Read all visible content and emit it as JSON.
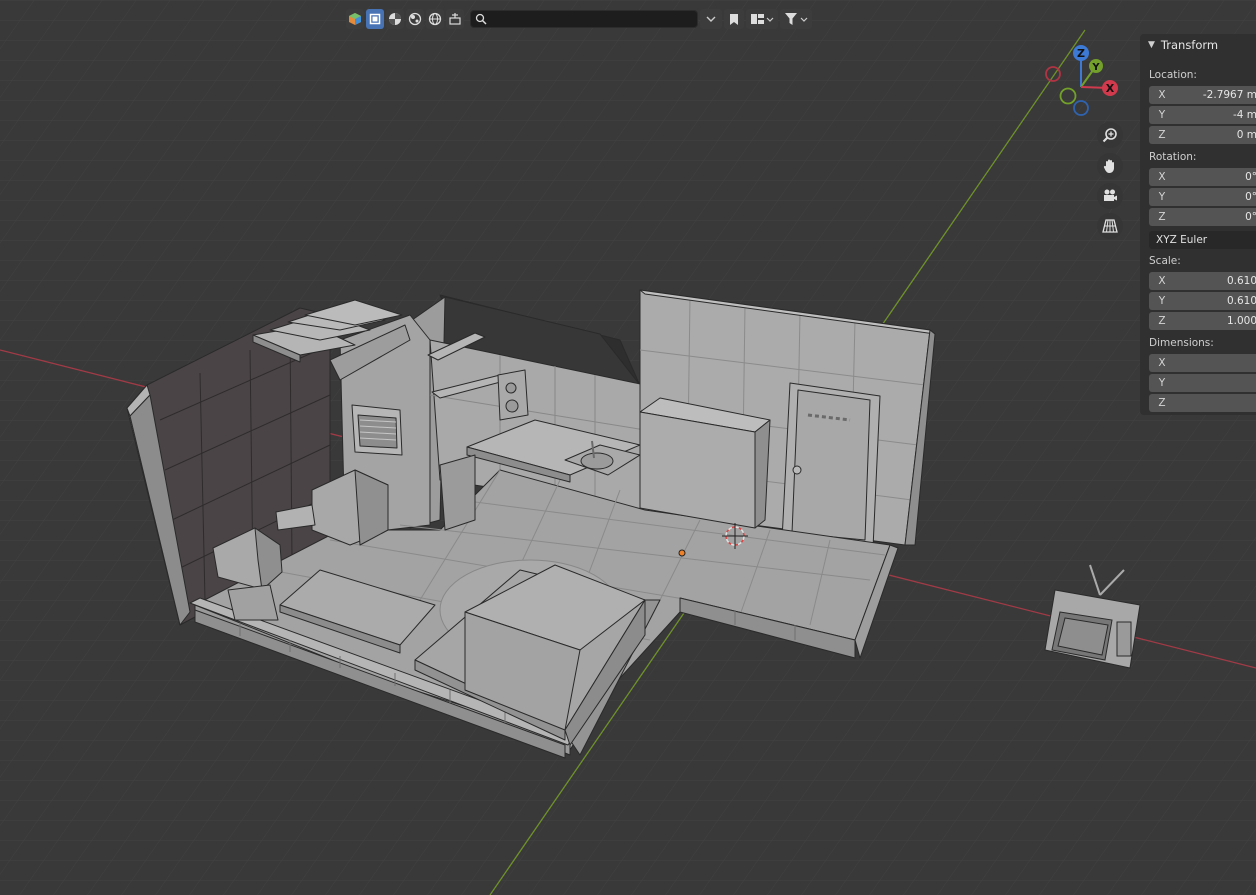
{
  "header": {
    "search": {
      "value": "",
      "placeholder": ""
    },
    "icons": [
      "object-type-icon",
      "solid-shading-icon",
      "material-shading-icon",
      "render-shading-icon",
      "wireframe-icon",
      "scene-options-icon",
      "search-icon",
      "collapse-icon",
      "bookmark-icon",
      "view-layer-icon",
      "filter-icon"
    ]
  },
  "gizmo": {
    "z": "Z",
    "y": "Y",
    "x": "X"
  },
  "nav": {
    "icons": [
      "zoom-icon",
      "pan-hand-icon",
      "camera-icon",
      "perspective-grid-icon"
    ]
  },
  "panel": {
    "title": "Transform",
    "location": {
      "label": "Location:",
      "x": "-2.7967 m",
      "y": "-4 m",
      "z": "0 m"
    },
    "rotation": {
      "label": "Rotation:",
      "x": "0°",
      "y": "0°",
      "z": "0°",
      "mode": "XYZ Euler"
    },
    "scale": {
      "label": "Scale:",
      "x": "0.610",
      "y": "0.610",
      "z": "1.000"
    },
    "dimensions": {
      "label": "Dimensions:",
      "x": "",
      "y": "",
      "z": ""
    },
    "axes": {
      "x": "X",
      "y": "Y",
      "z": "Z"
    }
  },
  "colors": {
    "background": "#393939",
    "grid": "#424242",
    "x_axis": "#b54551",
    "y_axis": "#7da02d",
    "model": "#a6a6a6",
    "panel": "#303030",
    "active": "#4772b3"
  }
}
